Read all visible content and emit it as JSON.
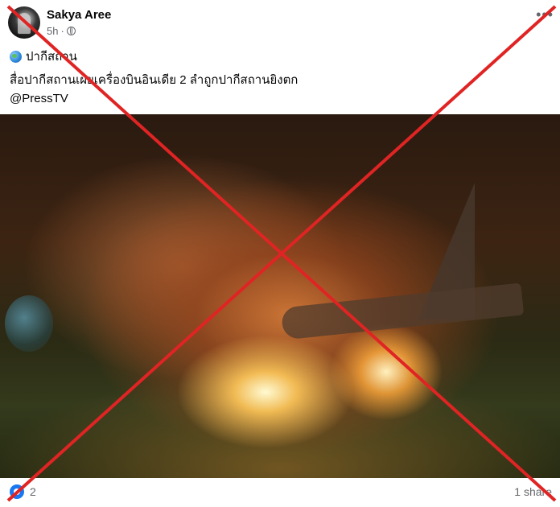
{
  "author": {
    "name": "Sakya Aree",
    "time": "5h",
    "audience_icon": "public-globe-icon"
  },
  "post": {
    "location_icon": "globe-icon",
    "location": "ปากีสถาน",
    "text": "สื่อปากีสถานเผยเครื่องบินอินเดีย 2 ลำถูกปากีสถานยิงตก",
    "source": "@PressTV"
  },
  "reactions": {
    "count": "2",
    "shares": "1 share"
  },
  "overlay": {
    "x_color": "#e02424"
  }
}
